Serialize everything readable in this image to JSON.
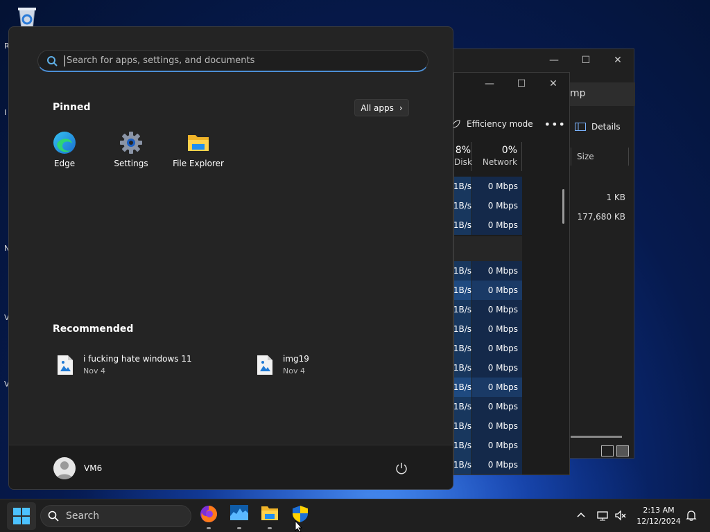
{
  "desktop": {
    "side_letters": [
      "R",
      "I",
      "N",
      "V",
      "V"
    ]
  },
  "back_window": {
    "address_fragment": "mp",
    "details_label": "Details",
    "column_size": "Size",
    "sizes": [
      "1 KB",
      "177,680 KB"
    ]
  },
  "task_manager": {
    "efficiency_label": "Efficiency mode",
    "more_label": "•••",
    "disk_pct": "8%",
    "disk_label": "Disk",
    "network_pct": "0%",
    "network_label": "Network",
    "disk_cell": "1B/s",
    "net_cell": "0 Mbps"
  },
  "start_menu": {
    "search_placeholder": "Search for apps, settings, and documents",
    "pinned_title": "Pinned",
    "all_apps_label": "All apps",
    "pinned": [
      {
        "label": "Edge",
        "icon": "edge-icon"
      },
      {
        "label": "Settings",
        "icon": "gear-icon"
      },
      {
        "label": "File Explorer",
        "icon": "folder-icon"
      }
    ],
    "recommended_title": "Recommended",
    "recommended": [
      {
        "title": "i fucking hate windows 11",
        "date": "Nov 4"
      },
      {
        "title": "img19",
        "date": "Nov 4"
      }
    ],
    "user_name": "VM6"
  },
  "taskbar": {
    "search_label": "Search",
    "time": "2:13 AM",
    "date": "12/12/2024"
  },
  "colors": {
    "accent": "#4c8fd6",
    "menu_bg": "#242424",
    "taskbar_bg": "#1f1f1f"
  }
}
